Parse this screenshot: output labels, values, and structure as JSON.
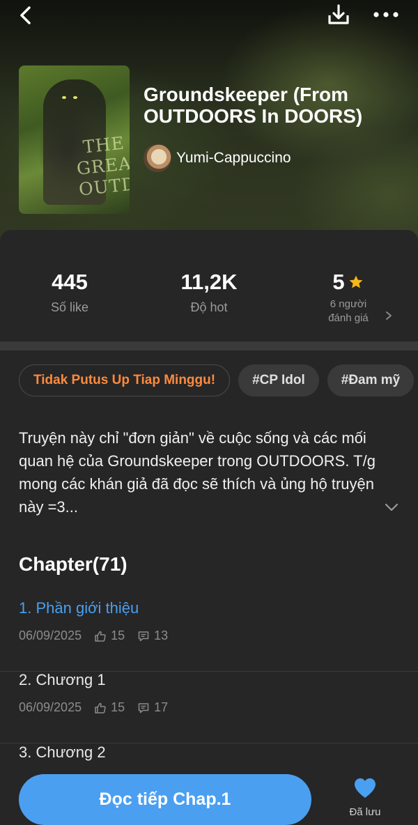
{
  "header": {
    "back_icon": "chevron-left-icon",
    "download_icon": "download-icon",
    "more_icon": "more-horizontal-icon"
  },
  "story": {
    "title": "Groundskeeper (From OUTDOORS In DOORS)",
    "cover_text": "THE GREAT OUTDOO",
    "author": "Yumi-Cappuccino"
  },
  "stats": {
    "likes_value": "445",
    "likes_label": "Số like",
    "hot_value": "11,2K",
    "hot_label": "Độ hot",
    "rating_value": "5",
    "rating_label_line1": "6 người",
    "rating_label_line2": "đánh giá",
    "star_color": "#f5b916"
  },
  "tags": [
    "Tidak Putus Up Tiap Minggu!",
    "#CP Idol",
    "#Đam mỹ"
  ],
  "description": "Truyện này chỉ \"đơn giản\" về cuộc sống và các mối quan hệ của Groundskeeper trong OUTDOORS. T/g mong các khán giả đã đọc sẽ thích và ủng hộ truyện này =3...",
  "chapters": {
    "heading": "Chapter(71)",
    "items": [
      {
        "title": "1. Phần giới thiệu",
        "date": "06/09/2025",
        "likes": "15",
        "comments": "13"
      },
      {
        "title": "2. Chương 1",
        "date": "06/09/2025",
        "likes": "15",
        "comments": "17"
      },
      {
        "title": "3. Chương 2",
        "date": "",
        "likes": "",
        "comments": ""
      }
    ]
  },
  "bottom": {
    "read_label": "Đọc tiếp Chap.1",
    "save_label": "Đã lưu",
    "accent": "#4a9ff0"
  }
}
